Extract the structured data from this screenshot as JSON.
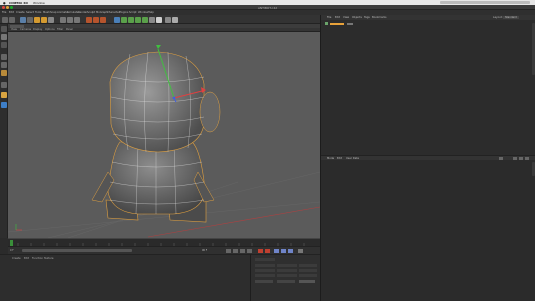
{
  "mac_menubar": {
    "app": "CINEMA 4D",
    "window": "Window"
  },
  "window": {
    "title": "ANTIBOT.c4d"
  },
  "menu": {
    "items": [
      "File",
      "Edit",
      "Create",
      "Select",
      "Tools",
      "Mesh",
      "Snap",
      "Animate",
      "Simulate",
      "Render",
      "Sculpt",
      "MoGraph",
      "Character",
      "Plugins",
      "Script",
      "Window",
      "Help"
    ]
  },
  "viewport": {
    "menu": [
      "View",
      "Cameras",
      "Display",
      "Options",
      "Filter",
      "Panel"
    ]
  },
  "object_manager": {
    "menu": [
      "File",
      "Edit",
      "View",
      "Objects",
      "Tags",
      "Bookmarks"
    ],
    "layout_label": "Layout:",
    "layout_value": "Standard"
  },
  "attribute_manager": {
    "menu": [
      "Mode",
      "Edit",
      "User Data"
    ]
  },
  "material_manager": {
    "menu": [
      "Create",
      "Edit",
      "Function",
      "Texture"
    ]
  },
  "timeline": {
    "start": "0 F",
    "end": "90 F",
    "current": "0 F"
  },
  "colors": {
    "accent": "#e8a23a",
    "viewport_bg": "#5b5b5b",
    "panel": "#2b2b2b"
  }
}
